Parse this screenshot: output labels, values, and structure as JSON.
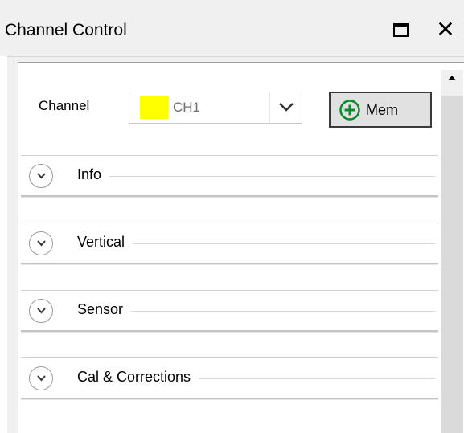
{
  "window": {
    "title": "Channel Control",
    "maximize_icon": "maximize-icon",
    "close_glyph": "✕"
  },
  "channel": {
    "label": "Channel",
    "selected": "CH1",
    "swatch_color": "#ffff00",
    "dropdown_icon": "chevron-down-icon"
  },
  "mem_button": {
    "label": "Mem",
    "icon": "plus-circle-icon",
    "icon_color": "#0a8a2a"
  },
  "sections": [
    {
      "label": "Info",
      "expanded": false
    },
    {
      "label": "Vertical",
      "expanded": false
    },
    {
      "label": "Sensor",
      "expanded": false
    },
    {
      "label": "Cal & Corrections",
      "expanded": false
    }
  ]
}
